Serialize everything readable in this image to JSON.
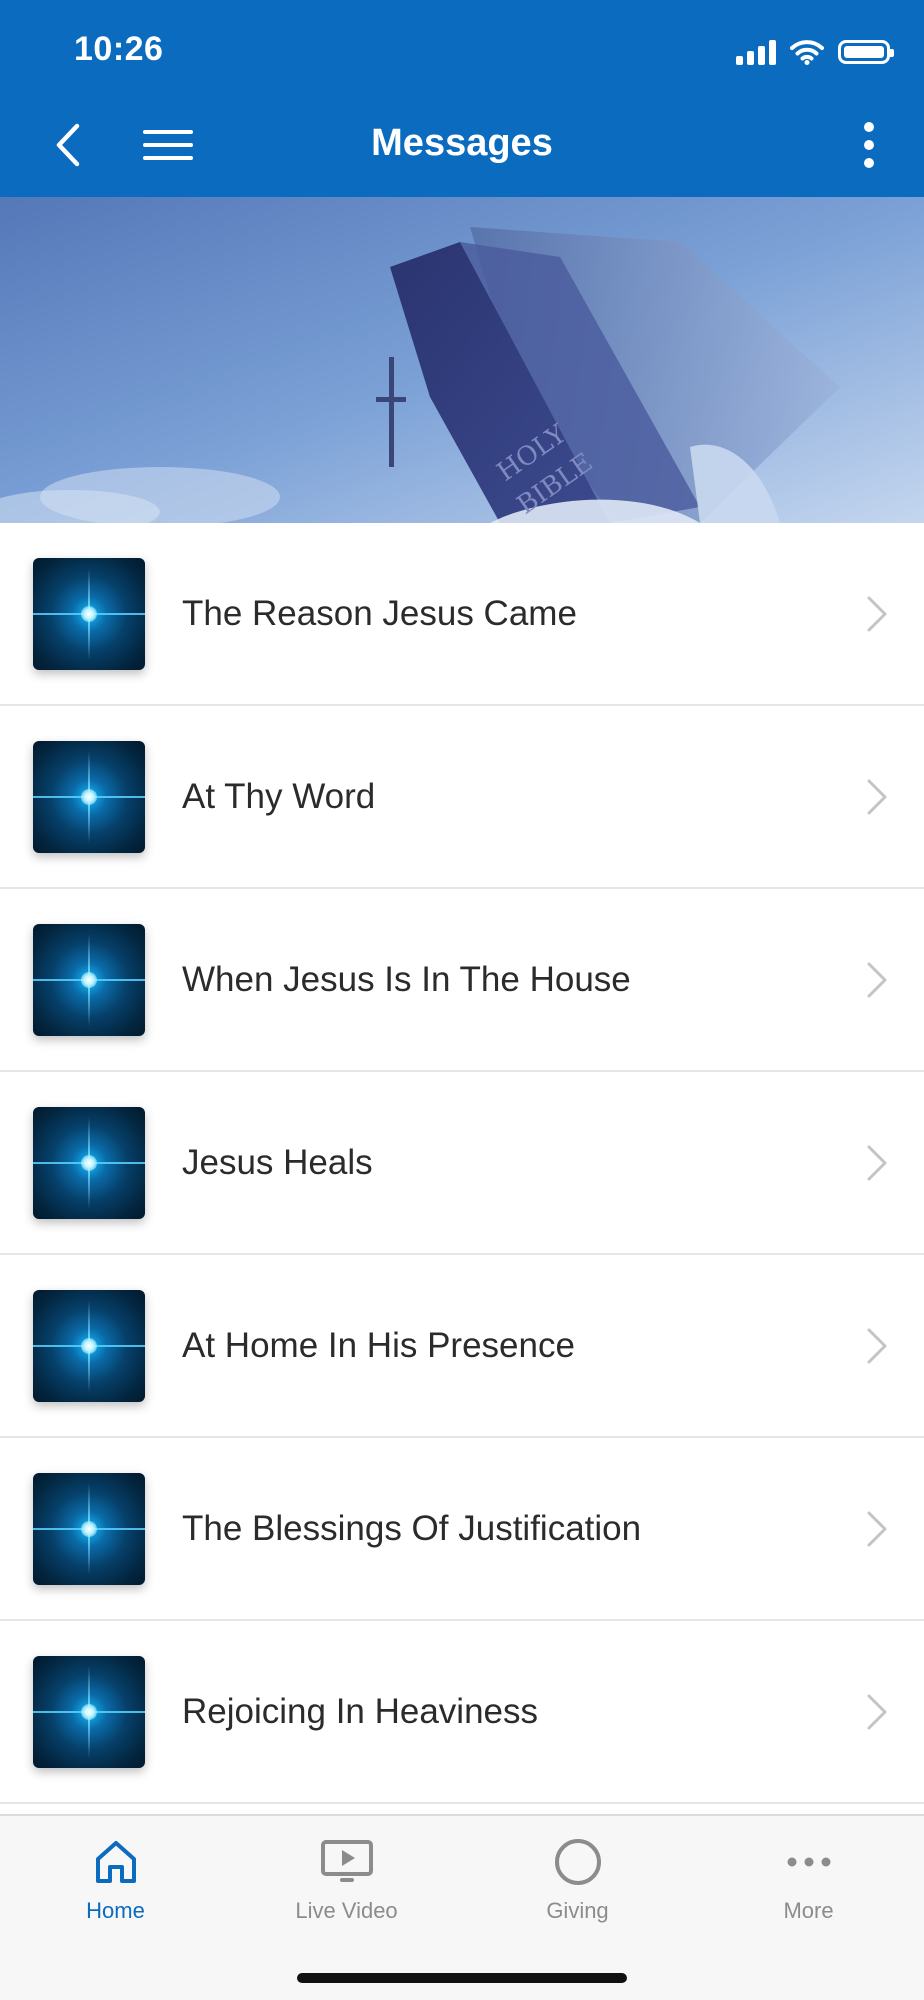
{
  "status_bar": {
    "time": "10:26",
    "icons": [
      "signal-icon",
      "wifi-icon",
      "battery-icon"
    ]
  },
  "app_bar": {
    "title": "Messages",
    "left_icons": [
      "back-icon",
      "hamburger-menu-icon"
    ],
    "right_icon": "more-vertical-icon",
    "background_color": "#0b6bbf"
  },
  "hero": {
    "image": "holy-bible-banner",
    "text_on_book": [
      "HOLY",
      "BIBLE"
    ]
  },
  "messages": [
    {
      "title": "The Reason Jesus Came"
    },
    {
      "title": "At Thy Word"
    },
    {
      "title": "When Jesus Is In The House"
    },
    {
      "title": "Jesus Heals"
    },
    {
      "title": "At Home In His Presence"
    },
    {
      "title": "The Blessings Of Justification"
    },
    {
      "title": "Rejoicing In Heaviness"
    }
  ],
  "tab_bar": {
    "active_color": "#0b6bbf",
    "inactive_color": "#8c8c8c",
    "tabs": [
      {
        "label": "Home",
        "icon": "home-icon",
        "active": true
      },
      {
        "label": "Live Video",
        "icon": "play-screen-icon",
        "active": false
      },
      {
        "label": "Giving",
        "icon": "circle-icon",
        "active": false
      },
      {
        "label": "More",
        "icon": "more-horizontal-icon",
        "active": false
      }
    ]
  }
}
